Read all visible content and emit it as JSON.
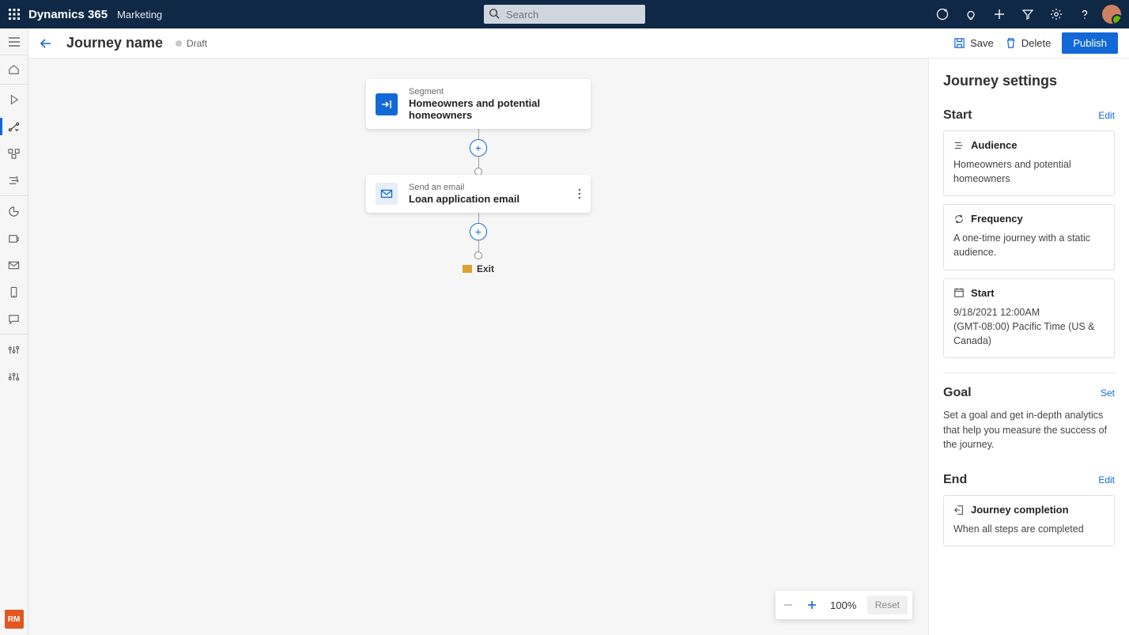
{
  "topbar": {
    "brand": "Dynamics 365",
    "app": "Marketing",
    "search_placeholder": "Search"
  },
  "leftrail": {
    "rm_initials": "RM"
  },
  "cmdbar": {
    "title": "Journey name",
    "status": "Draft",
    "save": "Save",
    "delete": "Delete",
    "publish": "Publish"
  },
  "flow": {
    "segment": {
      "label": "Segment",
      "title": "Homeowners and potential homeowners"
    },
    "email": {
      "label": "Send an email",
      "title": "Loan application email"
    },
    "exit": "Exit"
  },
  "zoom": {
    "value": "100%",
    "reset": "Reset"
  },
  "panel": {
    "title": "Journey settings",
    "start": {
      "heading": "Start",
      "edit": "Edit",
      "audience": {
        "label": "Audience",
        "value": "Homeowners and potential homeowners"
      },
      "frequency": {
        "label": "Frequency",
        "value": "A one-time journey with a static audience."
      },
      "start": {
        "label": "Start",
        "datetime": "9/18/2021 12:00AM",
        "tz": "(GMT-08:00) Pacific Time (US & Canada)"
      }
    },
    "goal": {
      "heading": "Goal",
      "set": "Set",
      "text": "Set a goal and get in-depth analytics that help you measure the success of the journey."
    },
    "end": {
      "heading": "End",
      "edit": "Edit",
      "completion": {
        "label": "Journey completion",
        "value": "When all steps are completed"
      }
    }
  }
}
